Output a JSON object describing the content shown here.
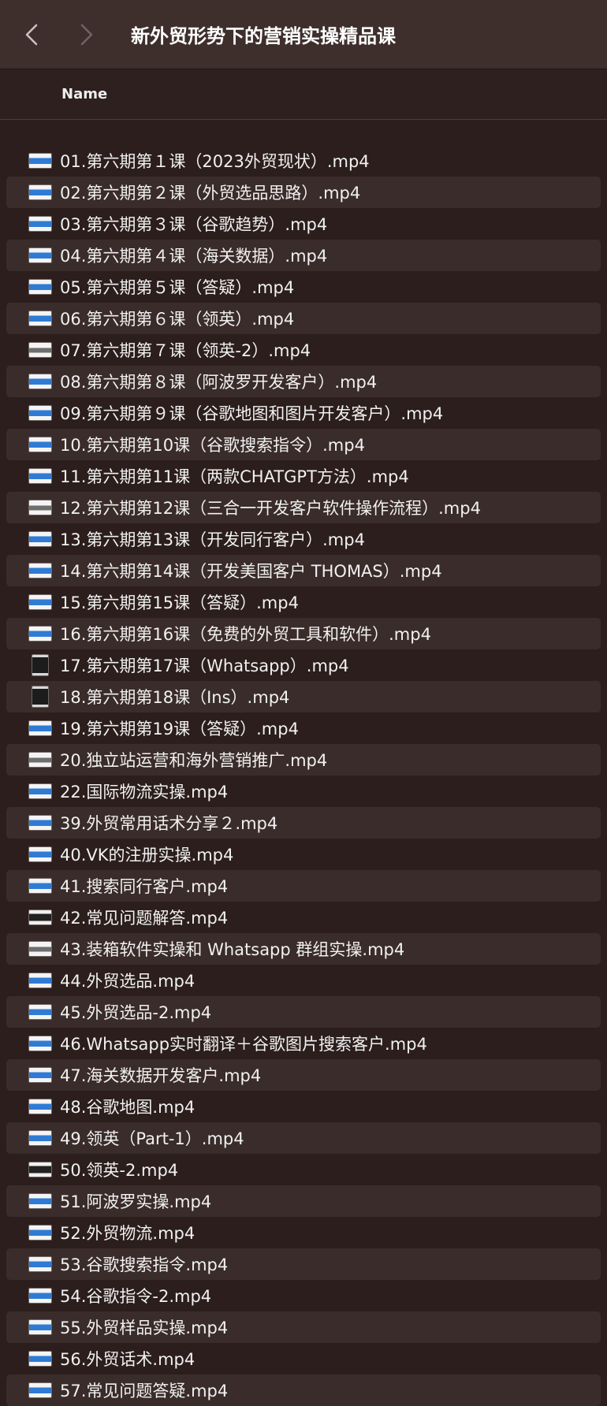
{
  "window": {
    "title": "新外贸形势下的营销实操精品课"
  },
  "navigation": {
    "back_icon": "chevron-left-icon",
    "forward_icon": "chevron-right-icon"
  },
  "list": {
    "column_header": "Name",
    "items": [
      "01.第六期第１课（2023外贸现状）.mp4",
      "02.第六期第２课（外贸选品思路）.mp4",
      "03.第六期第３课（谷歌趋势）.mp4",
      "04.第六期第４课（海关数据）.mp4",
      "05.第六期第５课（答疑）.mp4",
      "06.第六期第６课（领英）.mp4",
      "07.第六期第７课（领英-2）.mp4",
      "08.第六期第８课（阿波罗开发客户）.mp4",
      "09.第六期第９课（谷歌地图和图片开发客户）.mp4",
      "10.第六期第10课（谷歌搜索指令）.mp4",
      "11.第六期第11课（两款CHATGPT方法）.mp4",
      "12.第六期第12课（三合一开发客户软件操作流程）.mp4",
      "13.第六期第13课（开发同行客户）.mp4",
      "14.第六期第14课（开发美国客户 THOMAS）.mp4",
      "15.第六期第15课（答疑）.mp4",
      "16.第六期第16课（免费的外贸工具和软件）.mp4",
      "17.第六期第17课（Whatsapp）.mp4",
      "18.第六期第18课（Ins）.mp4",
      "19.第六期第19课（答疑）.mp4",
      "20.独立站运营和海外营销推广.mp4",
      "22.国际物流实操.mp4",
      "39.外贸常用话术分享２.mp4",
      "40.VK的注册实操.mp4",
      "41.搜索同行客户.mp4",
      "42.常见问题解答.mp4",
      "43.装箱软件实操和 Whatsapp 群组实操.mp4",
      "44.外贸选品.mp4",
      "45.外贸选品-2.mp4",
      "46.Whatsapp实时翻译＋谷歌图片搜索客户.mp4",
      "47.海关数据开发客户.mp4",
      "48.谷歌地图.mp4",
      "49.领英（Part-1）.mp4",
      "50.领英-2.mp4",
      "51.阿波罗实操.mp4",
      "52.外贸物流.mp4",
      "53.谷歌搜索指令.mp4",
      "54.谷歌指令-2.mp4",
      "55.外贸样品实操.mp4",
      "56.外贸话术.mp4",
      "57.常见问题答疑.mp4"
    ],
    "icon_name": "video-file-icon"
  }
}
